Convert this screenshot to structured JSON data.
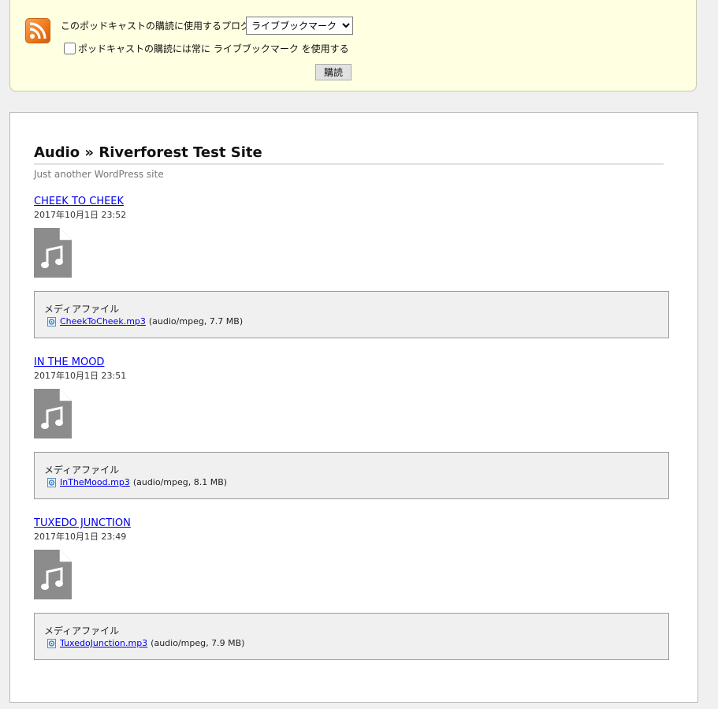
{
  "subscribe": {
    "label": "このポッドキャストの購読に使用するプログラム:",
    "program_selected": "ライブブックマーク",
    "always_use_label": "ポッドキャストの購読には常に ライブブックマーク を使用する",
    "always_use_checked": false,
    "button_label": "購読"
  },
  "feed": {
    "title": "Audio » Riverforest Test Site",
    "subtitle": "Just another WordPress site",
    "enclosure_heading": "メディアファイル",
    "entries": [
      {
        "title": "CHEEK TO CHEEK",
        "date": "2017年10月1日 23:52",
        "file": "CheekToCheek.mp3",
        "meta": "(audio/mpeg, 7.7 MB)"
      },
      {
        "title": "IN THE MOOD",
        "date": "2017年10月1日 23:51",
        "file": "InTheMood.mp3",
        "meta": "(audio/mpeg, 8.1 MB)"
      },
      {
        "title": "TUXEDO JUNCTION",
        "date": "2017年10月1日 23:49",
        "file": "TuxedoJunction.mp3",
        "meta": "(audio/mpeg, 7.9 MB)"
      }
    ]
  },
  "icons": {
    "feed": "rss-feed-icon",
    "audio_file": "audio-file-icon",
    "media_link": "media-file-icon"
  },
  "colors": {
    "banner_bg": "#ffffe1",
    "link": "#0000ee",
    "rss": "#ee7a1c",
    "icon_gray": "#8c8c8c"
  }
}
